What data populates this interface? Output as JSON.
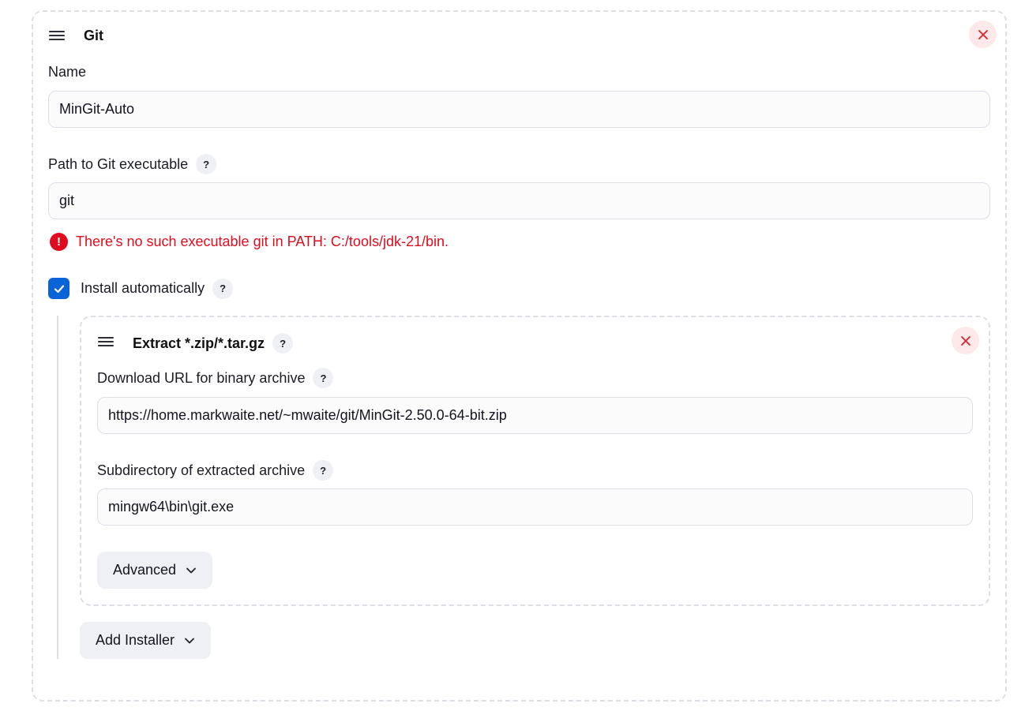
{
  "tool": {
    "title": "Git",
    "name_label": "Name",
    "name_value": "MinGit-Auto",
    "path_label": "Path to Git executable",
    "path_value": "git",
    "help_glyph": "?",
    "error_glyph": "!",
    "error_message": "There's no such executable git in PATH: C:/tools/jdk-21/bin.",
    "install_label": "Install automatically",
    "install_checked": true,
    "add_installer_label": "Add Installer"
  },
  "installer": {
    "title": "Extract *.zip/*.tar.gz",
    "url_label": "Download URL for binary archive",
    "url_value": "https://home.markwaite.net/~mwaite/git/MinGit-2.50.0-64-bit.zip",
    "subdir_label": "Subdirectory of extracted archive",
    "subdir_value": "mingw64\\bin\\git.exe",
    "advanced_label": "Advanced"
  },
  "colors": {
    "error": "#e00b1c",
    "checkbox": "#0b63d8",
    "close_bg": "#fde9e9",
    "close_icon": "#e0202e"
  },
  "icons": [
    "drag-handle-icon",
    "close-icon",
    "help-icon",
    "error-icon",
    "checkmark-icon",
    "chevron-down-icon"
  ]
}
